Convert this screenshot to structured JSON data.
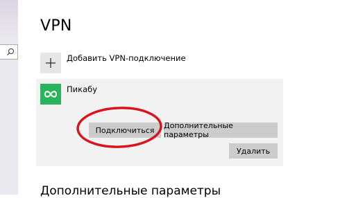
{
  "page": {
    "title": "VPN"
  },
  "add_vpn": {
    "label": "Добавить VPN-подключение",
    "icon": "plus-icon"
  },
  "connection": {
    "name": "Пикабу",
    "icon": "vpn-connection-icon",
    "icon_color": "#29b35c",
    "buttons": {
      "connect": "Подключиться",
      "advanced": "Дополнительные параметры",
      "delete": "Удалить"
    }
  },
  "section": {
    "heading": "Дополнительные параметры"
  },
  "colors": {
    "annotation": "#d8141c",
    "button_bg": "#cccccc",
    "card_bg": "#f2f2f2"
  }
}
